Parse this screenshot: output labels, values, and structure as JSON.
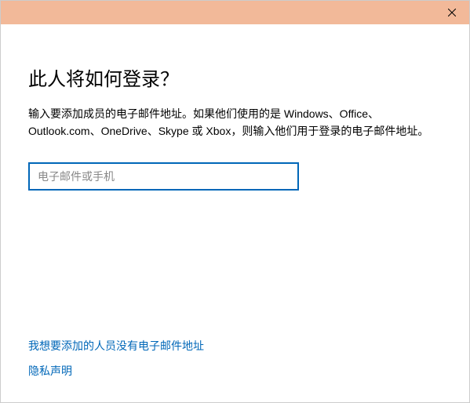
{
  "heading": "此人将如何登录？",
  "description": "输入要添加成员的电子邮件地址。如果他们使用的是 Windows、Office、Outlook.com、OneDrive、Skype 或 Xbox，则输入他们用于登录的电子邮件地址。",
  "input": {
    "placeholder": "电子邮件或手机",
    "value": ""
  },
  "links": {
    "no_email": "我想要添加的人员没有电子邮件地址",
    "privacy": "隐私声明"
  }
}
